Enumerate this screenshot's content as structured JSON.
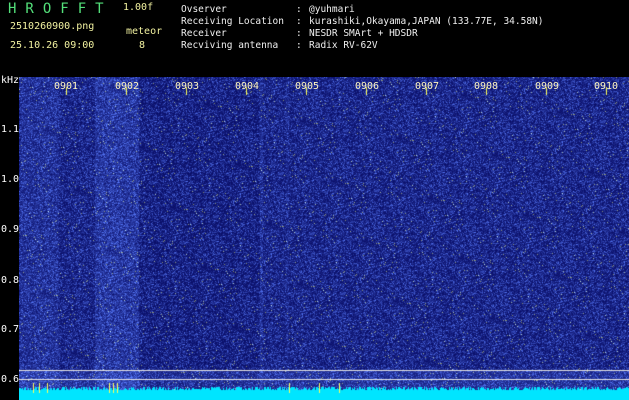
{
  "header": {
    "app_title": "HROFFT",
    "version": "1.00f",
    "filename": "2510260900.png",
    "timestamp": "25.10.26 09:00",
    "meteor_label": "meteor",
    "meteor_count": "8"
  },
  "info": [
    {
      "key": "Ovserver",
      "sep": ":",
      "value": "@yuhmari"
    },
    {
      "key": "Receiving Location",
      "sep": ":",
      "value": "kurashiki,Okayama,JAPAN (133.77E, 34.58N)"
    },
    {
      "key": "Receiver",
      "sep": ":",
      "value": "NESDR SMArt + HDSDR"
    },
    {
      "key": "Recviving antenna",
      "sep": ":",
      "value": "Radix RV-62V"
    }
  ],
  "axis": {
    "unit": "kHz",
    "y_ticks": [
      "1.1",
      "1.0",
      "0.9",
      "0.8",
      "0.7",
      "0.6"
    ],
    "x_ticks": [
      "0901",
      "0902",
      "0903",
      "0904",
      "0905",
      "0906",
      "0907",
      "0908",
      "0909",
      "0910"
    ]
  },
  "colors": {
    "background": "#000000",
    "noise_dark": "#000a6a",
    "noise_bright": "#5a78ff",
    "baseline": "#00e5ff",
    "grid_line": "#e6e6e6",
    "marker": "#ffff55"
  }
}
